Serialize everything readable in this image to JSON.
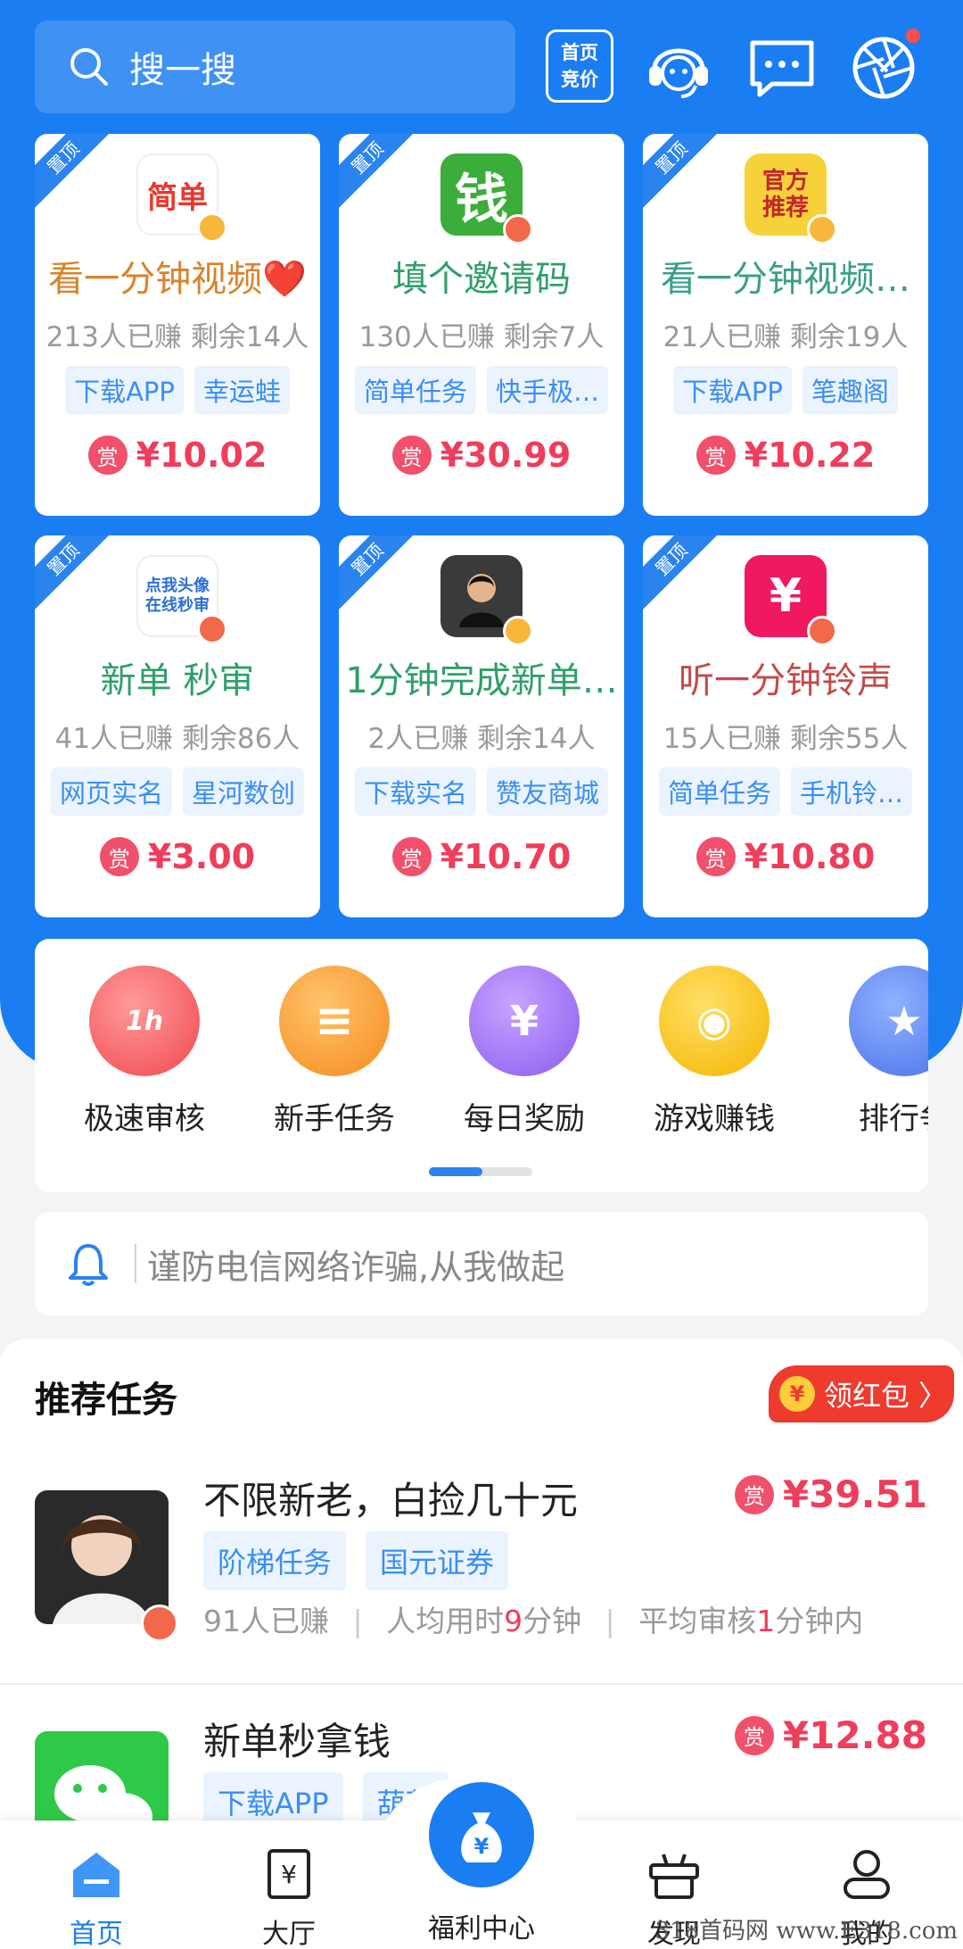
{
  "header": {
    "search_placeholder": "搜一搜",
    "bid_label_1": "首页",
    "bid_label_2": "竞价"
  },
  "pin_label": "置顶",
  "task_cards": [
    {
      "logo_text": "简单",
      "title": "看一分钟视频❤️",
      "earned": "213人已赚",
      "remaining": "剩余14人",
      "tags": [
        "下载APP",
        "幸运蛙"
      ],
      "reward": "¥10.02"
    },
    {
      "logo_text": "钱",
      "title": "填个邀请码",
      "earned": "130人已赚",
      "remaining": "剩余7人",
      "tags": [
        "简单任务",
        "快手极…"
      ],
      "reward": "¥30.99"
    },
    {
      "logo_text": "官方推荐",
      "title": "看一分钟视频…",
      "earned": "21人已赚",
      "remaining": "剩余19人",
      "tags": [
        "下载APP",
        "笔趣阁"
      ],
      "reward": "¥10.22"
    },
    {
      "logo_text": "点我头像在线秒审",
      "title": "新单 秒审",
      "earned": "41人已赚",
      "remaining": "剩余86人",
      "tags": [
        "网页实名",
        "星河数创"
      ],
      "reward": "¥3.00"
    },
    {
      "logo_text": "",
      "title": "1分钟完成新单…",
      "earned": "2人已赚",
      "remaining": "剩余14人",
      "tags": [
        "下载实名",
        "赞友商城"
      ],
      "reward": "¥10.70"
    },
    {
      "logo_text": "¥",
      "title": "听一分钟铃声",
      "earned": "15人已赚",
      "remaining": "剩余55人",
      "tags": [
        "简单任务",
        "手机铃…"
      ],
      "reward": "¥10.80"
    }
  ],
  "reward_badge": "赏",
  "features": [
    {
      "label": "极速审核",
      "icon_text": "1h"
    },
    {
      "label": "新手任务",
      "icon_text": "≡"
    },
    {
      "label": "每日奖励",
      "icon_text": "¥"
    },
    {
      "label": "游戏赚钱",
      "icon_text": "◉"
    },
    {
      "label": "排行争",
      "icon_text": "★"
    }
  ],
  "notice": "谨防电信网络诈骗,从我做起",
  "recommend": {
    "title": "推荐任务",
    "hongbao_label": "领红包 〉",
    "hongbao_icon": "¥",
    "items": [
      {
        "name": "不限新老，白捡几十元",
        "price": "¥39.51",
        "tags": [
          "阶梯任务",
          "国元证券"
        ],
        "earned": "91人已赚",
        "time_prefix": "人均用时",
        "time_value": "9",
        "time_suffix": "分钟",
        "review_prefix": "平均审核",
        "review_value": "1",
        "review_suffix": "分钟内"
      },
      {
        "name": "新单秒拿钱",
        "price": "¥12.88",
        "tags": [
          "下载APP",
          "葫芦"
        ]
      }
    ]
  },
  "nav": {
    "home": "首页",
    "hall": "大厅",
    "welfare": "福利中心",
    "discover": "发现",
    "mine": "我的"
  },
  "watermark": "318首码网 www.E318.com"
}
